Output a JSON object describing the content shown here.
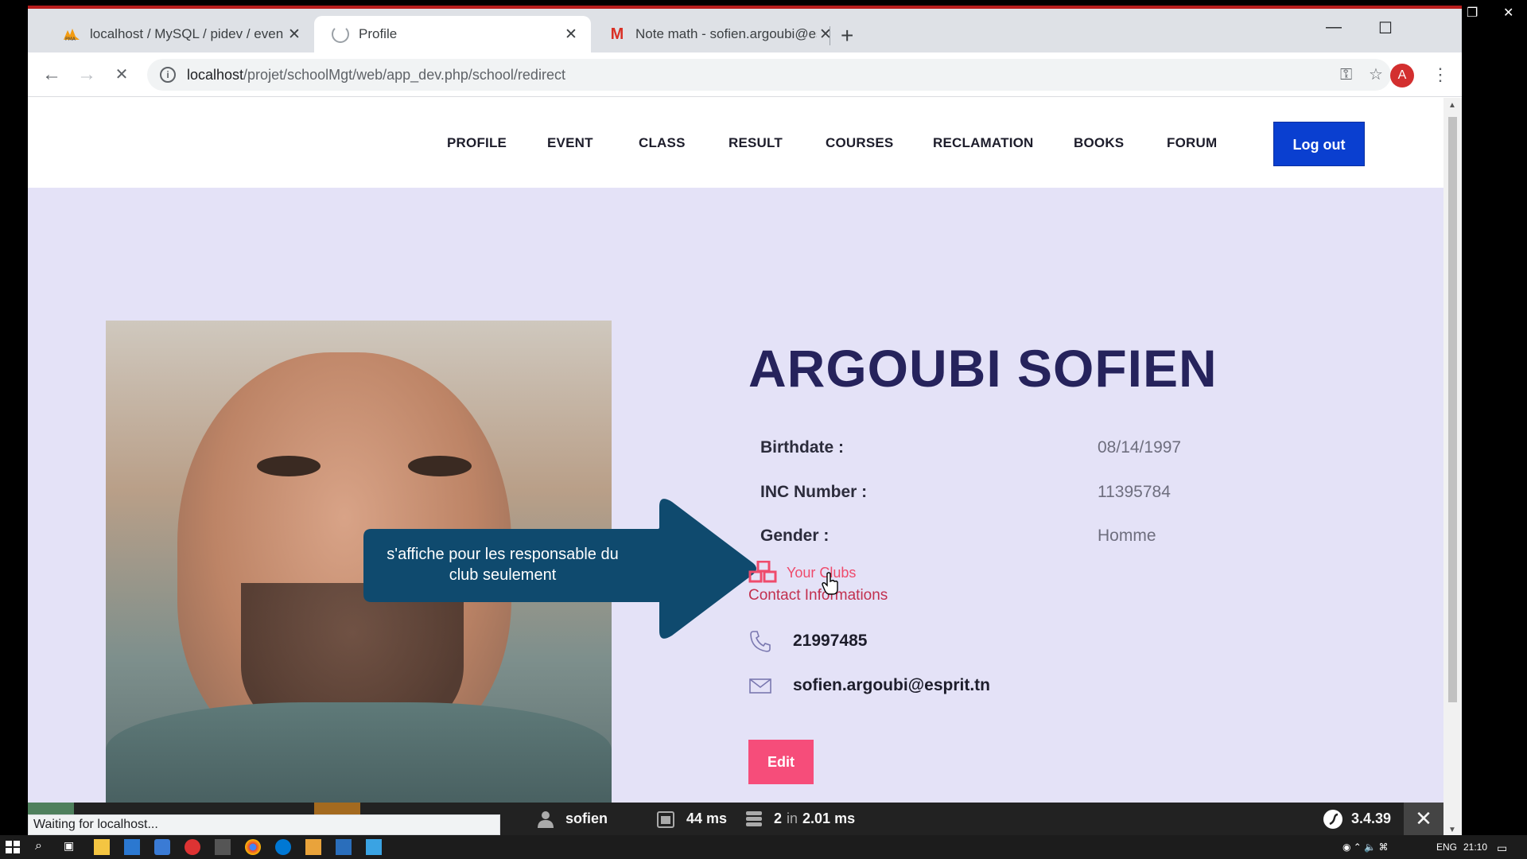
{
  "browser": {
    "tabs": [
      {
        "title": "localhost / MySQL / pidev / even",
        "icon": "phpmyadmin-icon",
        "active": false
      },
      {
        "title": "Profile",
        "icon": "loading-spinner-icon",
        "active": true
      },
      {
        "title": "Note math - sofien.argoubi@esp",
        "icon": "gmail-icon",
        "active": false
      }
    ],
    "new_tab_symbol": "+",
    "url_host": "localhost",
    "url_path": "/projet/schoolMgt/web/app_dev.php/school/redirect",
    "profile_initial": "A",
    "status_text": "Waiting for localhost..."
  },
  "nav": {
    "items": [
      "PROFILE",
      "EVENT",
      "CLASS",
      "RESULT",
      "COURSES",
      "RECLAMATION",
      "BOOKS",
      "FORUM"
    ],
    "logout_label": "Log out"
  },
  "profile": {
    "name": "ARGOUBI SOFIEN",
    "fields": [
      {
        "label": "Birthdate :",
        "value": "08/14/1997"
      },
      {
        "label": "INC Number :",
        "value": "11395784"
      },
      {
        "label": "Gender :",
        "value": "Homme"
      }
    ],
    "clubs_link": "Your Clubs",
    "contact_heading": "Contact Informations",
    "phone": "21997485",
    "email": "sofien.argoubi@esprit.tn",
    "edit_label": "Edit"
  },
  "callout": {
    "text": "s'affiche pour les responsable du club seulement",
    "color": "#0f4a6e"
  },
  "debug_toolbar": {
    "user": "sofien",
    "time": "44 ms",
    "db_queries": "2",
    "db_in": "in",
    "db_time": "2.01 ms",
    "version": "3.4.39"
  },
  "taskbar": {
    "lang": "ENG",
    "time": "21:10"
  },
  "colors": {
    "page_bg": "#e4e2f7",
    "accent_blue": "#0a3fd0",
    "accent_pink": "#f64d7a",
    "name_color": "#26235c"
  }
}
